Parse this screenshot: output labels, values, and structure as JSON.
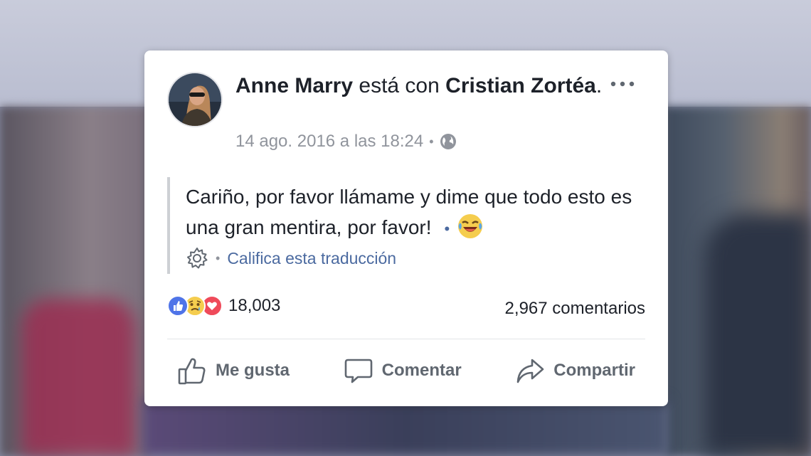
{
  "post": {
    "author": "Anne Marry",
    "connector": "está con",
    "tagged": "Cristian Zortéa",
    "tagged_suffix": ".",
    "timestamp": "14 ago. 2016 a las 18:24",
    "separator": "•",
    "privacy_icon": "globe-icon",
    "text": "Cariño, por favor llámame y dime que todo esto es una gran mentira, por favor!",
    "text_suffix_dot": "•",
    "translation_separator": "•",
    "translation_link": "Califica esta traducción"
  },
  "stats": {
    "reactions_count": "18,003",
    "comments_count": "2,967 comentarios",
    "reaction_icons": [
      "like-icon",
      "sad-icon",
      "love-icon"
    ]
  },
  "actions": {
    "like": "Me gusta",
    "comment": "Comentar",
    "share": "Compartir"
  },
  "colors": {
    "link_blue": "#4b6aa0",
    "like_blue": "#4f74e8",
    "love_red": "#ef4a5a",
    "sad_yellow": "#f5cd4e",
    "muted_text": "#90949c"
  }
}
